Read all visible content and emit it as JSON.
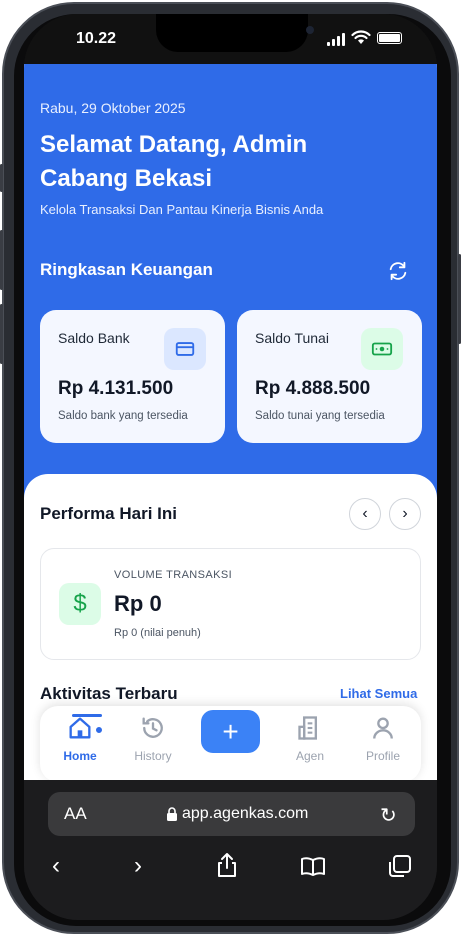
{
  "status": {
    "time": "10.22"
  },
  "header": {
    "date": "Rabu, 29 Oktober 2025",
    "greeting": "Selamat Datang, Admin Cabang Bekasi",
    "subtitle": "Kelola Transaksi Dan Pantau Kinerja Bisnis Anda"
  },
  "summary": {
    "title": "Ringkasan Keuangan",
    "refresh_icon": "refresh-icon",
    "cards": [
      {
        "label": "Saldo Bank",
        "value": "Rp 4.131.500",
        "note": "Saldo bank yang tersedia",
        "icon": "credit-card-icon",
        "icon_bg": "#dbe7ff",
        "icon_color": "#2f6be8"
      },
      {
        "label": "Saldo Tunai",
        "value": "Rp 4.888.500",
        "note": "Saldo tunai yang tersedia",
        "icon": "banknote-icon",
        "icon_bg": "#dcfce7",
        "icon_color": "#16a34a"
      }
    ]
  },
  "performance": {
    "title": "Performa Hari Ini",
    "volume_caption": "VOLUME TRANSAKSI",
    "volume_value": "Rp 0",
    "volume_note": "Rp 0 (nilai penuh)",
    "icon": "dollar-icon"
  },
  "activity": {
    "title": "Aktivitas Terbaru",
    "see_all": "Lihat Semua"
  },
  "nav": {
    "items": [
      {
        "label": "Home",
        "icon": "home-icon",
        "active": true
      },
      {
        "label": "History",
        "icon": "history-icon",
        "active": false
      },
      {
        "label": "Agen",
        "icon": "building-icon",
        "active": false
      },
      {
        "label": "Profile",
        "icon": "user-icon",
        "active": false
      }
    ],
    "add_icon": "plus-icon"
  },
  "browser": {
    "aa": "AA",
    "url": "app.agenkas.com"
  },
  "colors": {
    "primary": "#2f6be8",
    "success": "#16a34a"
  }
}
